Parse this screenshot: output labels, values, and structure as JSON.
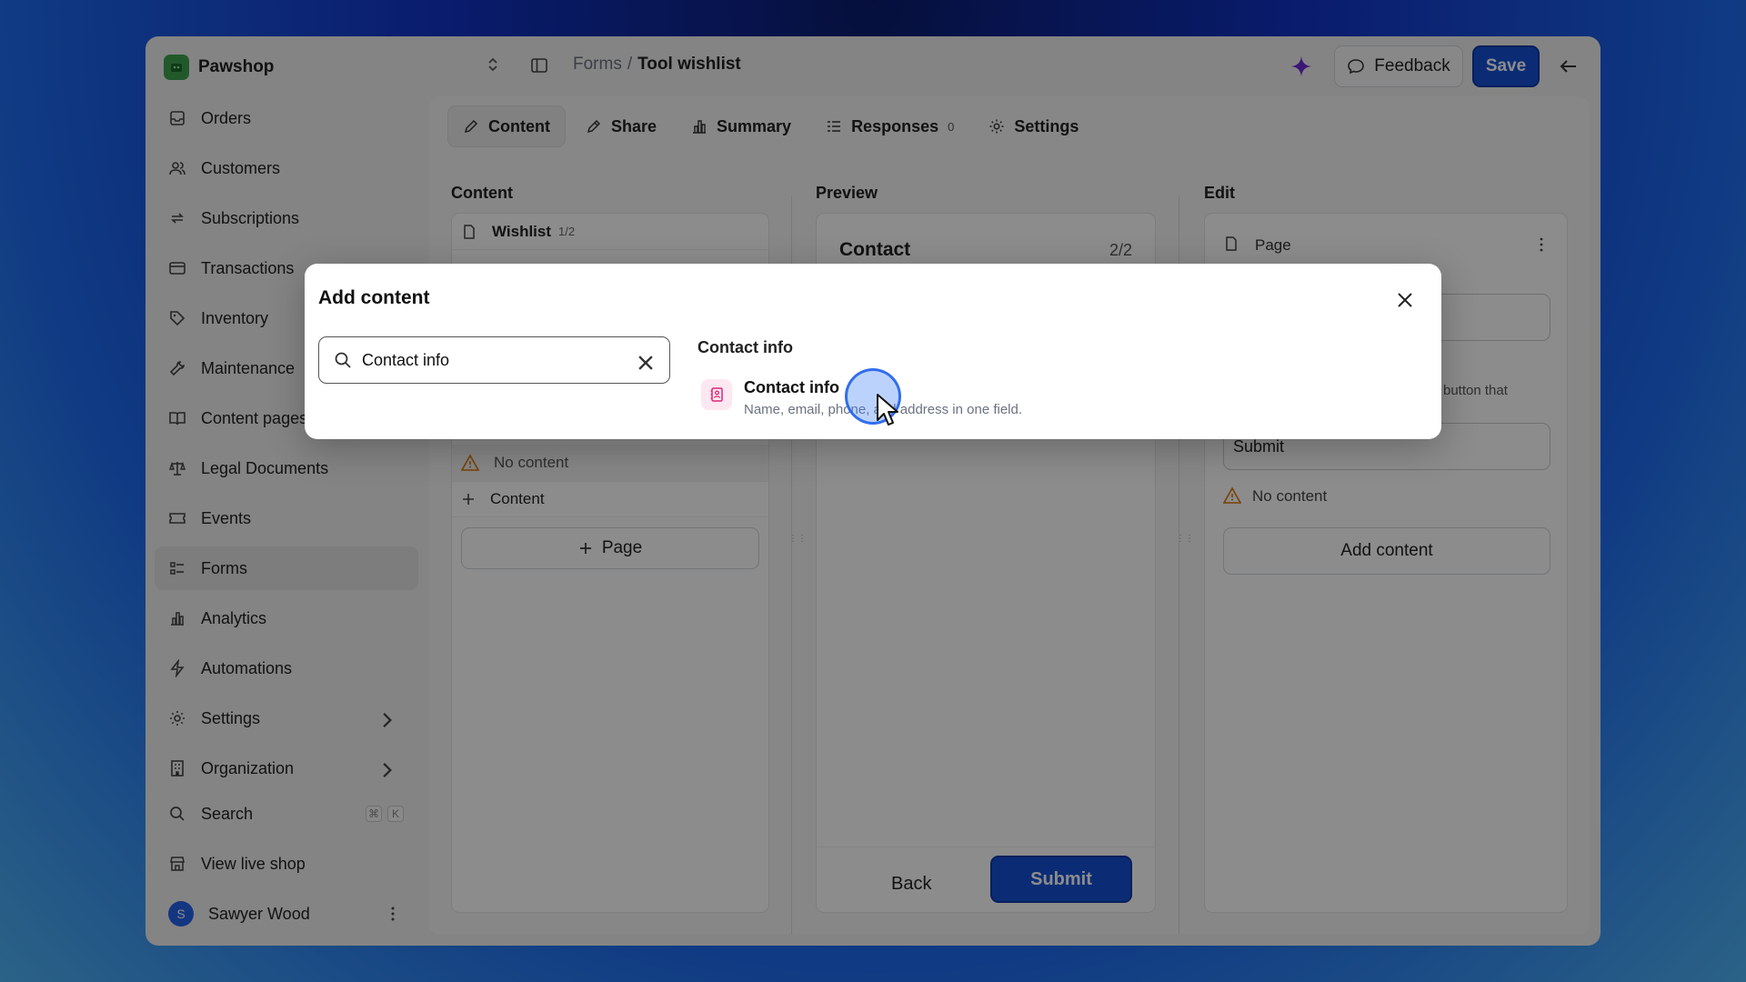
{
  "app": {
    "shop_name": "Pawshop"
  },
  "breadcrumb": {
    "parent": "Forms",
    "separator": "/",
    "current": "Tool wishlist"
  },
  "header": {
    "feedback_label": "Feedback",
    "save_label": "Save"
  },
  "sidebar": {
    "items": [
      {
        "label": "Orders",
        "icon": "inbox-icon"
      },
      {
        "label": "Customers",
        "icon": "users-icon"
      },
      {
        "label": "Subscriptions",
        "icon": "repeat-icon"
      },
      {
        "label": "Transactions",
        "icon": "credit-card-icon"
      },
      {
        "label": "Inventory",
        "icon": "tag-icon"
      },
      {
        "label": "Maintenance",
        "icon": "wrench-icon"
      },
      {
        "label": "Content pages",
        "icon": "book-icon"
      },
      {
        "label": "Legal Documents",
        "icon": "scale-icon"
      },
      {
        "label": "Events",
        "icon": "ticket-icon"
      },
      {
        "label": "Forms",
        "icon": "form-icon",
        "active": true
      },
      {
        "label": "Analytics",
        "icon": "bar-chart-icon"
      },
      {
        "label": "Automations",
        "icon": "zap-icon"
      },
      {
        "label": "Settings",
        "icon": "gear-icon"
      },
      {
        "label": "Organization",
        "icon": "building-icon"
      }
    ],
    "search_label": "Search",
    "search_shortcut": [
      "⌘",
      "K"
    ],
    "live_shop_label": "View live shop",
    "user": {
      "initial": "S",
      "name": "Sawyer Wood"
    }
  },
  "tabs": [
    {
      "label": "Content",
      "icon": "pencil-icon",
      "active": true
    },
    {
      "label": "Share",
      "icon": "share-icon"
    },
    {
      "label": "Summary",
      "icon": "bar-chart-icon"
    },
    {
      "label": "Responses",
      "icon": "list-icon",
      "count": "0"
    },
    {
      "label": "Settings",
      "icon": "gear-icon"
    }
  ],
  "content_col": {
    "title": "Content",
    "page1_label": "Wishlist",
    "page1_count": "1/2",
    "no_content": "No content",
    "add_content_row": "Content",
    "add_page_label": "Page"
  },
  "preview_col": {
    "title": "Preview",
    "page_title": "Contact",
    "page_count": "2/2",
    "back_label": "Back",
    "submit_label": "Submit"
  },
  "edit_col": {
    "title": "Edit",
    "page_label": "Page",
    "hint_fragment": "button that",
    "submit_value": "Submit",
    "no_content": "No content",
    "add_content_label": "Add content"
  },
  "modal": {
    "title": "Add content",
    "search_value": "Contact info",
    "results_heading": "Contact info",
    "result": {
      "title": "Contact info",
      "description": "Name, email, phone, and address in one field.",
      "icon": "contact-card-icon"
    }
  }
}
